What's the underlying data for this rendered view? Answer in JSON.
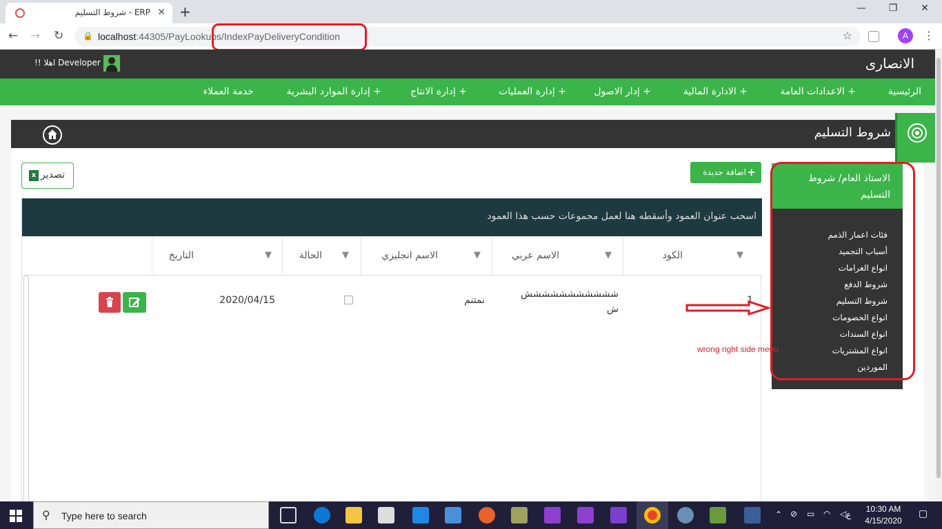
{
  "browser": {
    "tab_title": "ERP - شروط التسليم",
    "tab_close": "✕",
    "new_tab": "+",
    "url_host": "localhost",
    "url_rest": ":44305/PayLookups/IndexPayDeliveryCondition",
    "profile_initial": "A"
  },
  "header": {
    "brand": "الانصارى",
    "greeting": "!! اهلا Developer"
  },
  "nav": {
    "items": [
      "الرئيسية",
      "الاعدادات العامة +",
      "الادارة المالية +",
      "إدار الاصول +",
      "إدارة العمليات +",
      "إدارة الانتاج +",
      "إدارة الموارد البشرية +",
      "خدمة العملاء"
    ]
  },
  "page": {
    "title": "شروط التسليم",
    "export_label": "تصدير",
    "add_label": "اضافة جديدة",
    "group_hint": "اسحب عنوان العمود وأسقطه هنا لعمل مجموعات حسب هذا العمود"
  },
  "grid": {
    "columns": [
      "الكود",
      "الاسم عربي",
      "الاسم انجليزي",
      "الحالة",
      "التاريخ"
    ],
    "rows": [
      {
        "code": "1",
        "name_ar": "ششششششششششش ش",
        "name_ar_line1": "ششششششششششش",
        "name_ar_line2": "ش",
        "name_en": "نمتنم",
        "status_checked": false,
        "date": "2020/04/15"
      }
    ]
  },
  "side_menu": {
    "header": "الاستاذ العام/ شروط التسليم",
    "items": [
      "فئات اعمار الذمم",
      "أسباب التجميد",
      "انواع الغرامات",
      "شروط الدفع",
      "شروط التسليم",
      "انواع الخصومات",
      "انواع السندات",
      "انواع المشتريات",
      "الموردين"
    ]
  },
  "annotation": {
    "text": "wrong right side menu"
  },
  "taskbar": {
    "search_placeholder": "Type here to search",
    "time": "10:30 AM",
    "date": "4/15/2020",
    "lang": "ع"
  },
  "colors": {
    "brand_green": "#3bb44a",
    "dark_bar": "#343434",
    "group_bar": "#1e3a41",
    "annotation_red": "#e31b23"
  }
}
